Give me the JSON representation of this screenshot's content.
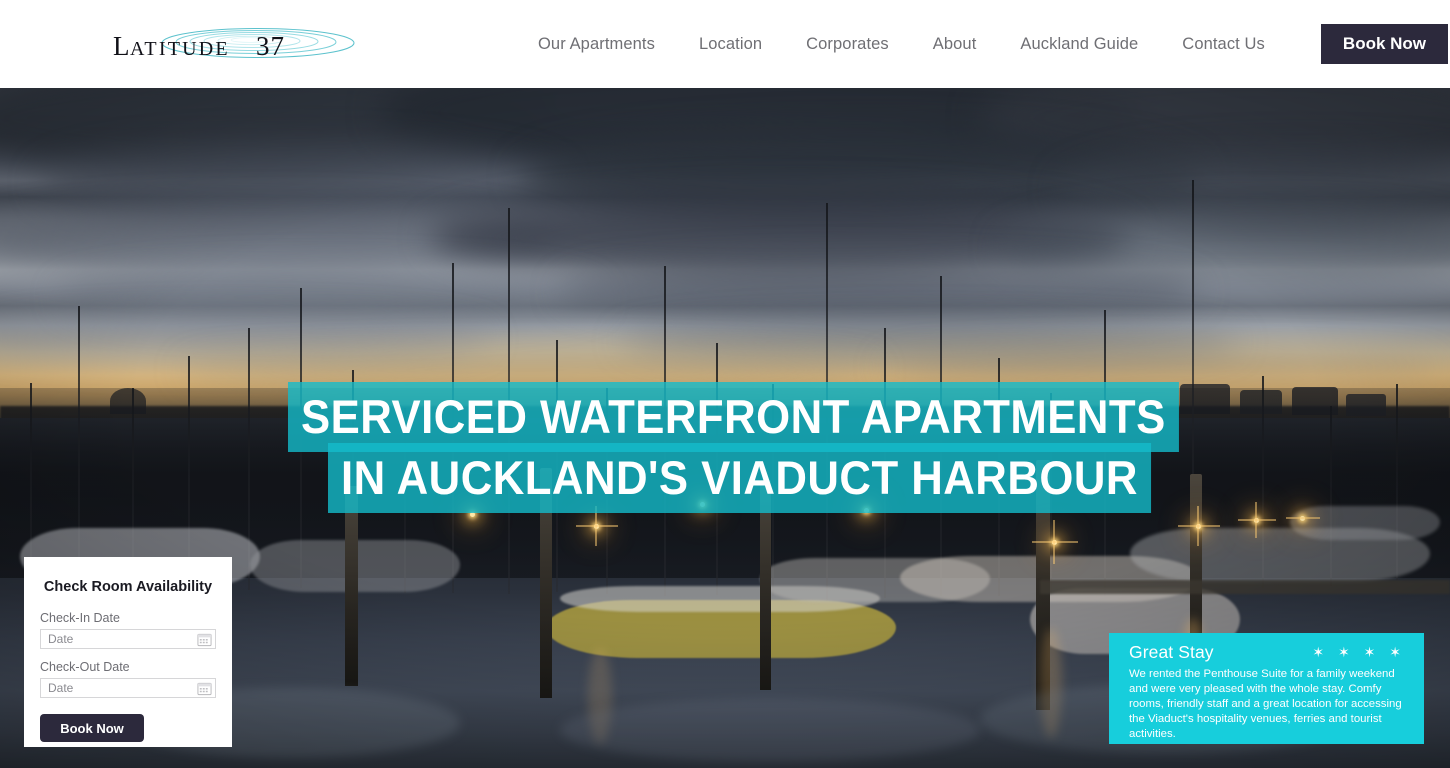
{
  "brand": {
    "logo_text": "LATITUDE 37",
    "logo_name": "latitude-37-logo"
  },
  "nav": {
    "items": [
      {
        "label": "Our Apartments",
        "name": "nav-our-apartments"
      },
      {
        "label": "Location",
        "name": "nav-location"
      },
      {
        "label": "Corporates",
        "name": "nav-corporates"
      },
      {
        "label": "About",
        "name": "nav-about"
      },
      {
        "label": "Auckland Guide",
        "name": "nav-auckland-guide"
      },
      {
        "label": "Contact Us",
        "name": "nav-contact-us"
      }
    ],
    "book_now": "Book Now"
  },
  "hero": {
    "headline_line1": "SERVICED WATERFRONT APARTMENTS",
    "headline_line2": "IN AUCKLAND'S VIADUCT HARBOUR",
    "image_description": "Auckland Viaduct Harbour marina at dusk with moored yachts, dock lights and storm clouds"
  },
  "booking": {
    "title": "Check Room Availability",
    "checkin_label": "Check-In Date",
    "checkin_value": "",
    "checkin_placeholder": "Date",
    "checkout_label": "Check-Out Date",
    "checkout_value": "",
    "checkout_placeholder": "Date",
    "submit_label": "Book Now",
    "calendar_icon": "calendar-icon"
  },
  "testimonial": {
    "title": "Great Stay",
    "stars": "✶ ✶ ✶ ✶",
    "star_count": 4,
    "body": "We rented the Penthouse Suite for a family weekend and were very pleased with the whole stay. Comfy rooms, friendly staff and a great location for accessing the Viaduct's hospitality venues, ferries and tourist activities."
  },
  "colors": {
    "accent_teal": "#17cedc",
    "headline_bar": "rgba(20,188,202,0.80)",
    "dark_button": "#2c293c",
    "nav_text": "#6f6f74"
  }
}
